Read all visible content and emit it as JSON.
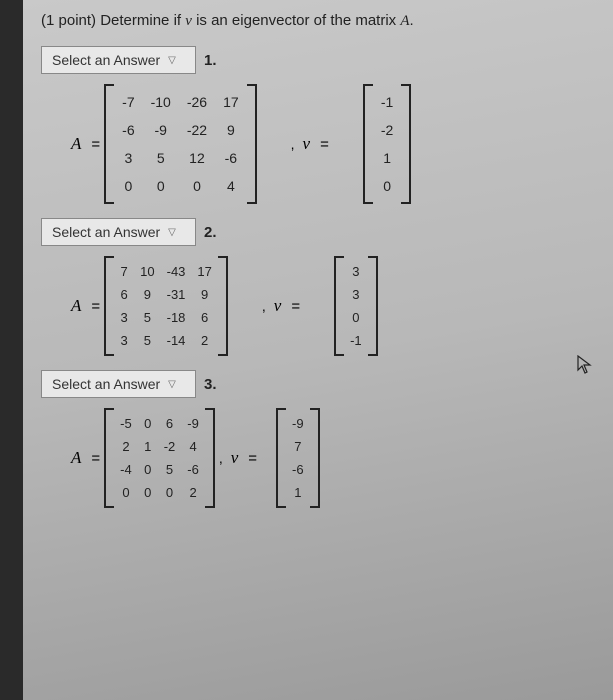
{
  "question": {
    "points": "(1 point)",
    "text_before_v": "Determine if ",
    "v_symbol": "v",
    "text_mid": " is an eigenvector of the matrix ",
    "A_symbol": "A",
    "text_after": "."
  },
  "select_label": "Select an Answer",
  "items": [
    {
      "number": "1.",
      "matrix_A": [
        [
          "-7",
          "-10",
          "-26",
          "17"
        ],
        [
          "-6",
          "-9",
          "-22",
          "9"
        ],
        [
          "3",
          "5",
          "12",
          "-6"
        ],
        [
          "0",
          "0",
          "0",
          "4"
        ]
      ],
      "vector_v": [
        "-1",
        "-2",
        "1",
        "0"
      ]
    },
    {
      "number": "2.",
      "matrix_A": [
        [
          "7",
          "10",
          "-43",
          "17"
        ],
        [
          "6",
          "9",
          "-31",
          "9"
        ],
        [
          "3",
          "5",
          "-18",
          "6"
        ],
        [
          "3",
          "5",
          "-14",
          "2"
        ]
      ],
      "vector_v": [
        "3",
        "3",
        "0",
        "-1"
      ]
    },
    {
      "number": "3.",
      "matrix_A": [
        [
          "-5",
          "0",
          "6",
          "-9"
        ],
        [
          "2",
          "1",
          "-2",
          "4"
        ],
        [
          "-4",
          "0",
          "5",
          "-6"
        ],
        [
          "0",
          "0",
          "0",
          "2"
        ]
      ],
      "vector_v": [
        "-9",
        "7",
        "-6",
        "1"
      ]
    }
  ],
  "labels": {
    "A": "A",
    "eq": "=",
    "v": "v",
    "comma": ","
  }
}
